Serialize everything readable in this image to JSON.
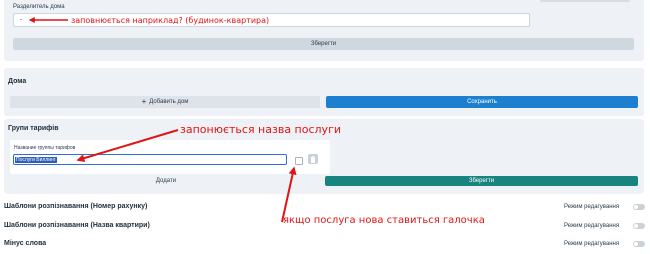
{
  "house_separator": {
    "label": "Разделитель дома",
    "value": "-",
    "save_button": "Зберегти"
  },
  "houses": {
    "title": "Дома",
    "add_button": "Добавить дом",
    "save_button": "Сохранить"
  },
  "tariff_groups": {
    "title": "Групи тарифів",
    "field_label": "Название группы тарифов",
    "field_value": "Послуги Биллинг",
    "add_button": "Додати",
    "save_button": "Зберегти"
  },
  "settings_rows": [
    {
      "title": "Шаблони розпізнавання (Номер рахунку)",
      "mode_label": "Режим редагування"
    },
    {
      "title": "Шаблони розпізнавання (Назва квартири)",
      "mode_label": "Режим редагування"
    },
    {
      "title": "Мінус слова",
      "mode_label": "Режим редагування"
    }
  ],
  "annotations": {
    "separator_note": "заповнюється наприклад? (будинок-квартира)",
    "service_name_note": "запонюється назва послуги",
    "checkbox_note": "якщо послуга нова ставиться галочка"
  },
  "colors": {
    "panel_bg": "#eef2f6",
    "blue_button": "#1c7fd0",
    "teal_button": "#19847f",
    "annotation_red": "#e01414"
  }
}
